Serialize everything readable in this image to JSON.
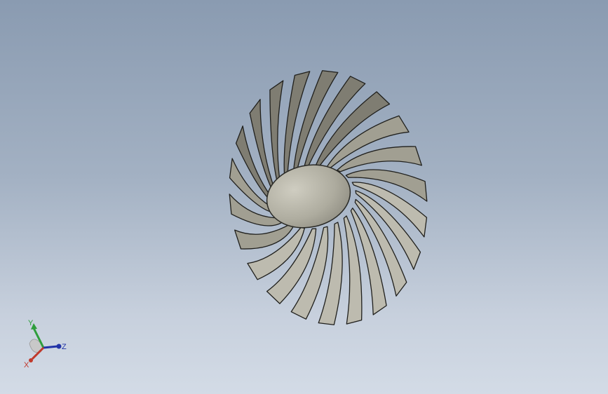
{
  "scene": {
    "background_top": "#8a9bb1",
    "background_bottom": "#d3dbe6",
    "model": {
      "blade_count": 22,
      "blade_fill": "#a19f92",
      "blade_light": "#bdbbaf",
      "blade_dark": "#7f7d72",
      "hub_fill": "#aeac9f"
    }
  },
  "triad": {
    "x_label": "X",
    "y_label": "Y",
    "z_label": "Z",
    "x_color": "#c0392b",
    "y_color": "#2e9e3c",
    "z_color": "#2234a8"
  }
}
